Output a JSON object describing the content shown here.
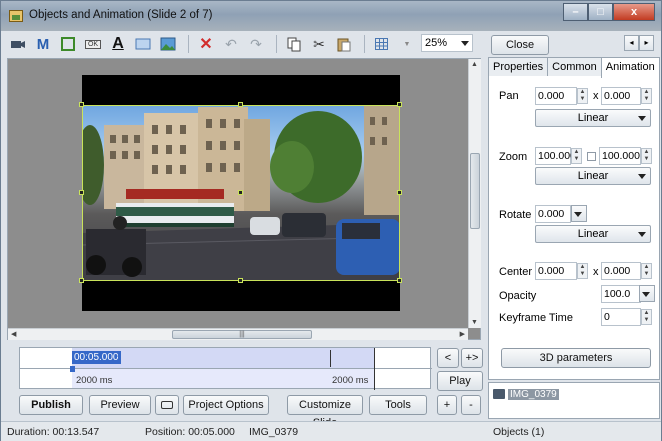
{
  "window": {
    "title": "Objects and Animation  (Slide 2 of 7)",
    "controls": {
      "minimize": "–",
      "maximize": "□",
      "close": "x"
    }
  },
  "toolbar": {
    "items": [
      {
        "icon": "camera-icon"
      },
      {
        "icon": "M-text-icon",
        "label": "M"
      },
      {
        "icon": "frame-icon"
      },
      {
        "icon": "ok-button-icon",
        "label": "OK"
      },
      {
        "icon": "text-A-icon",
        "label": "A"
      },
      {
        "icon": "rectangle-icon"
      },
      {
        "icon": "image-icon"
      },
      {
        "icon": "delete-icon",
        "label": "✕"
      },
      {
        "icon": "undo-icon",
        "label": "↶"
      },
      {
        "icon": "redo-icon",
        "label": "↷"
      },
      {
        "icon": "copy-icon"
      },
      {
        "icon": "cut-icon",
        "label": "✂"
      },
      {
        "icon": "paste-icon"
      },
      {
        "icon": "grid-icon"
      }
    ],
    "zoom": "25%",
    "delete_color": "#d22d2d"
  },
  "timeline": {
    "position": "00:05.000",
    "dash": "-",
    "left_ms": "2000 ms",
    "right_ms": "2000 ms",
    "nav_prev": "<",
    "nav_expand": "+>",
    "play": "Play",
    "add": "+",
    "remove": "-"
  },
  "bottom_buttons": {
    "publish": "Publish",
    "preview": "Preview",
    "project_options": "Project Options",
    "customize_slide": "Customize Slide",
    "tools": "Tools"
  },
  "panel": {
    "close": "Close",
    "nav_left": "◂",
    "nav_right": "▸",
    "tabs": [
      "Properties",
      "Common",
      "Animation"
    ],
    "active_tab": "Animation",
    "pan": {
      "label": "Pan",
      "x": "0.000",
      "sep": "x",
      "y": "0.000",
      "mode": "Linear"
    },
    "zoom": {
      "label": "Zoom",
      "x": "100.000",
      "y": "100.000",
      "mode": "Linear"
    },
    "rotate": {
      "label": "Rotate",
      "value": "0.000",
      "mode": "Linear"
    },
    "center": {
      "label": "Center",
      "x": "0.000",
      "sep": "x",
      "y": "0.000"
    },
    "opacity": {
      "label": "Opacity",
      "value": "100.0"
    },
    "keyframe_time": {
      "label": "Keyframe Time",
      "value": "0"
    },
    "params_button": "3D parameters"
  },
  "objects": {
    "items": [
      "IMG_0379"
    ]
  },
  "status": {
    "duration": "Duration: 00:13.547",
    "position": "Position: 00:05.000",
    "file": "IMG_0379",
    "objects": "Objects (1)"
  }
}
